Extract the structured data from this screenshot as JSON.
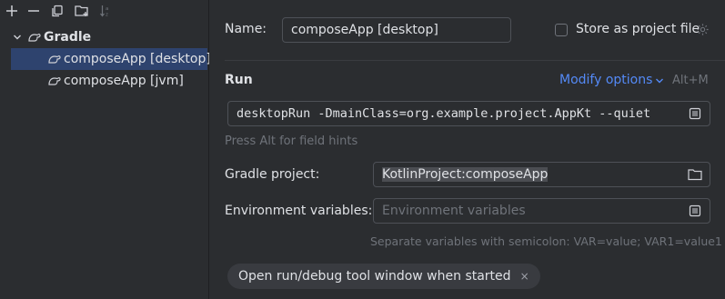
{
  "toolbar": {
    "icons": [
      "add-icon",
      "remove-icon",
      "copy-icon",
      "new-folder-icon",
      "sort-icon"
    ]
  },
  "tree": {
    "group_label": "Gradle",
    "items": [
      {
        "label": "composeApp [desktop]",
        "selected": true
      },
      {
        "label": "composeApp [jvm]",
        "selected": false
      }
    ]
  },
  "form": {
    "name_label": "Name:",
    "name_value": "composeApp [desktop]",
    "store_label": "Store as project file",
    "run_section": "Run",
    "modify_options": "Modify options",
    "modify_shortcut": "Alt+M",
    "command_value": "desktopRun -DmainClass=org.example.project.AppKt --quiet",
    "field_hint": "Press Alt for field hints",
    "gradle_project_label": "Gradle project:",
    "gradle_project_value": "KotlinProject:composeApp",
    "env_label": "Environment variables:",
    "env_placeholder": "Environment variables",
    "env_hint": "Separate variables with semicolon: VAR=value; VAR1=value1",
    "chip_label": "Open run/debug tool window when started",
    "chip_close": "×"
  },
  "colors": {
    "background": "#2b2d30",
    "selection": "#2e436e",
    "link": "#548af7",
    "border": "#4e5157",
    "hint": "#6f737a"
  }
}
